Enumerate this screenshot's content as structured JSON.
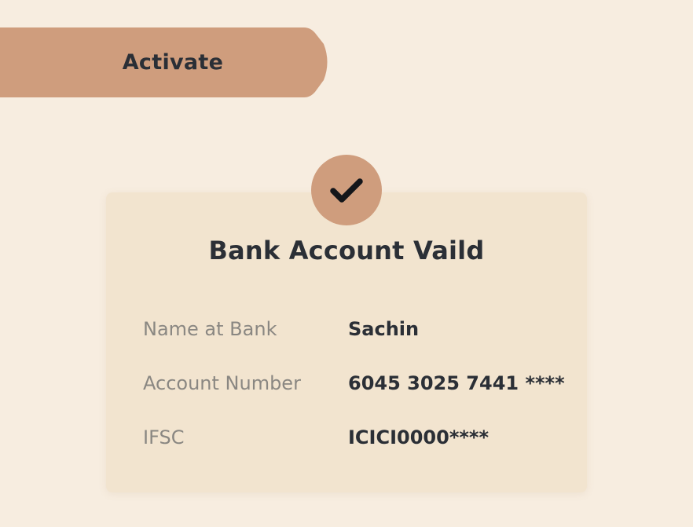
{
  "tab": {
    "label": "Activate"
  },
  "card": {
    "title": "Bank Account Vaild",
    "rows": [
      {
        "label": "Name at Bank",
        "value": "Sachin"
      },
      {
        "label": "Account Number",
        "value": "6045 3025 7441 ****"
      },
      {
        "label": "IFSC",
        "value": "ICICI0000****"
      }
    ]
  },
  "colors": {
    "background": "#f7ede0",
    "accent": "#cf9d7d",
    "card": "#f2e4cf",
    "text_dark": "#2b2f36",
    "text_muted": "#8a8782"
  },
  "icons": {
    "badge": "checkmark-icon"
  }
}
